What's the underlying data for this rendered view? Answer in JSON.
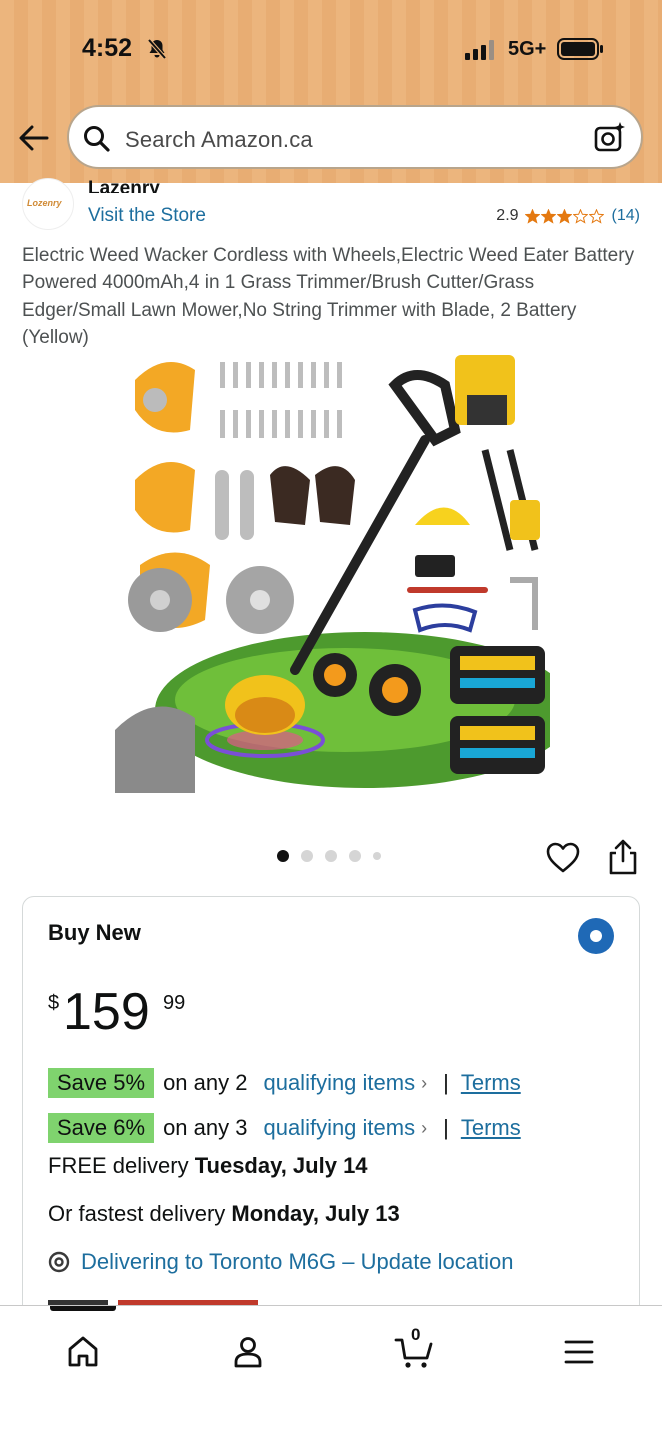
{
  "status_bar": {
    "time": "4:52",
    "network": "5G+",
    "icons": [
      "bell-slash-icon",
      "signal-icon",
      "battery-icon"
    ]
  },
  "header": {
    "back_icon": "arrow-left-icon",
    "search": {
      "placeholder": "Search Amazon.ca",
      "icon": "search-icon",
      "camera_icon": "camera-lens-icon"
    }
  },
  "brand": {
    "logo_text": "Lozenry",
    "name": "Lazenry",
    "visit_store": "Visit the Store"
  },
  "rating": {
    "value": "2.9",
    "stars_filled": 2.9,
    "stars_total": 5,
    "count": "(14)"
  },
  "product": {
    "title": "Electric Weed Wacker Cordless with Wheels,Electric Weed Eater Battery Powered 4000mAh,4 in 1 Grass Trimmer/Brush Cutter/Grass Edger/Small Lawn Mower,No String Trimmer with Blade, 2 Battery (Yellow)",
    "image_dots": 5,
    "active_dot": 0
  },
  "buy_box": {
    "label": "Buy New",
    "price": {
      "symbol": "$",
      "whole": "159",
      "fraction": "99"
    },
    "promotions": [
      {
        "badge": "Save 5%",
        "text": "on any 2",
        "link": "qualifying items",
        "chevron": "›",
        "separator": "|",
        "terms": "Terms"
      },
      {
        "badge": "Save 6%",
        "text": "on any 3",
        "link": "qualifying items",
        "chevron": "›",
        "separator": "|",
        "terms": "Terms"
      }
    ],
    "delivery": {
      "free_prefix": "FREE delivery",
      "free_date": "Tuesday, July 14",
      "fastest_prefix": "Or fastest delivery",
      "fastest_date": "Monday, July 13"
    },
    "location": "Delivering to Toronto M6G – Update location"
  },
  "bottom_nav": {
    "items": [
      "home-icon",
      "account-icon",
      "cart-icon",
      "menu-icon"
    ],
    "cart_count": "0"
  },
  "colors": {
    "header": "#ecb57d",
    "link": "#1d6e9e",
    "star": "#e47911",
    "promo_badge": "#7fd36e",
    "radio": "#1f69b6"
  }
}
